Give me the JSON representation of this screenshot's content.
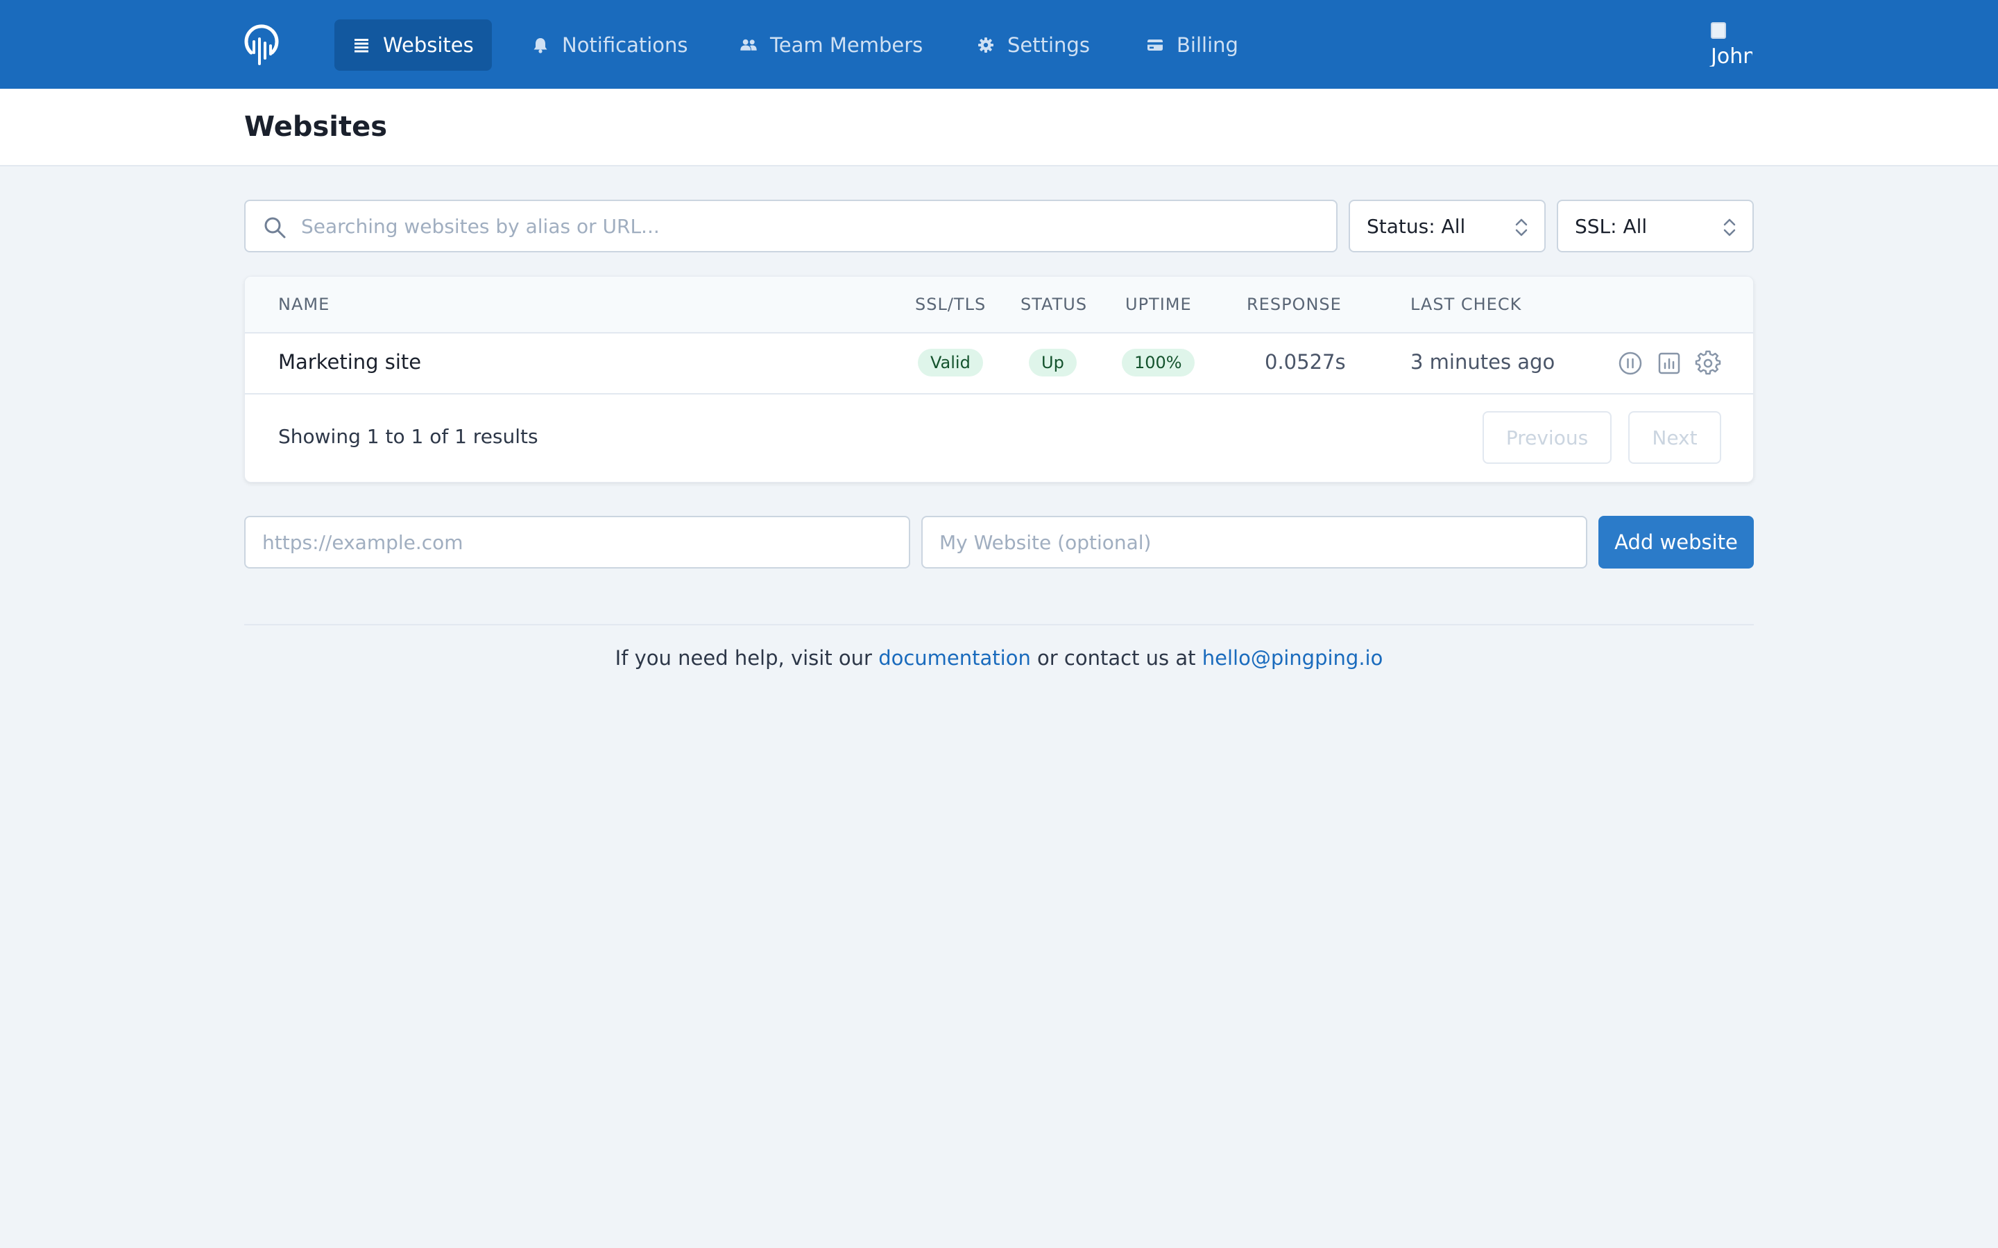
{
  "nav": {
    "items": [
      {
        "label": "Websites",
        "icon": "list-icon",
        "active": true
      },
      {
        "label": "Notifications",
        "icon": "bell-icon"
      },
      {
        "label": "Team Members",
        "icon": "users-icon"
      },
      {
        "label": "Settings",
        "icon": "gear-icon"
      },
      {
        "label": "Billing",
        "icon": "credit-card-icon"
      }
    ],
    "avatar_alt": "John"
  },
  "header": {
    "title": "Websites"
  },
  "filters": {
    "search_placeholder": "Searching websites by alias or URL...",
    "status_select": "Status: All",
    "ssl_select": "SSL: All"
  },
  "table": {
    "columns": {
      "name": "NAME",
      "ssl": "SSL/TLS",
      "status": "STATUS",
      "uptime": "UPTIME",
      "response": "RESPONSE",
      "last_check": "LAST CHECK"
    },
    "rows": [
      {
        "name": "Marketing site",
        "ssl": "Valid",
        "status": "Up",
        "uptime": "100%",
        "response": "0.0527s",
        "last_check": "3 minutes ago"
      }
    ],
    "showing": "Showing 1 to 1 of 1 results",
    "previous": "Previous",
    "next": "Next"
  },
  "add_form": {
    "url_placeholder": "https://example.com",
    "name_placeholder": "My Website (optional)",
    "button": "Add website"
  },
  "footer": {
    "text_before": "If you need help, visit our",
    "docs_link": "documentation",
    "text_middle": "or contact us at",
    "email": "hello@pingping.io"
  },
  "colors": {
    "nav_bg": "#1a6bbd",
    "nav_active": "#12589f",
    "accent": "#2b7bc9",
    "badge_bg": "#dff5ea",
    "page_bg": "#f0f4f8"
  }
}
